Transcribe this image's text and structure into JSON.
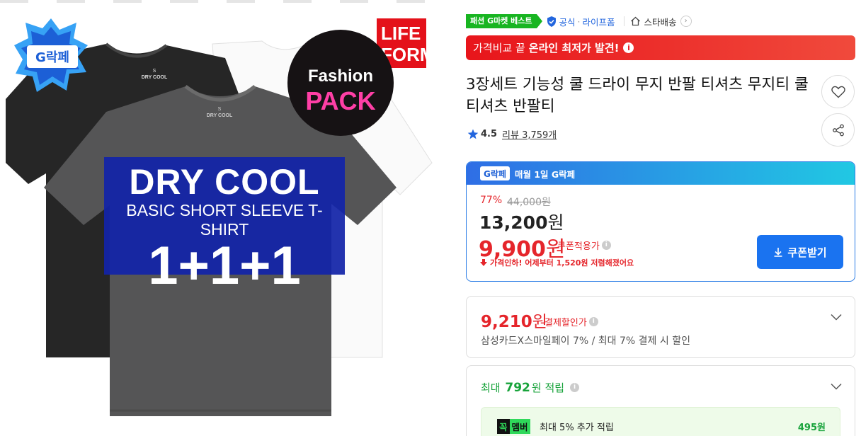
{
  "image": {
    "badge_text": "G락페",
    "life_text": "LIFE\nFORM",
    "fashion_pack_line1": "Fashion",
    "fashion_pack_line2": "PACK",
    "banner_line1": "DRY COOL",
    "banner_line2": "BASIC SHORT SLEEVE T-SHIRT",
    "banner_line3": "1+1+1",
    "label_size": "S",
    "label_brand": "DRY COOL"
  },
  "tags": {
    "best": "패션 G마켓 베스트",
    "official": "공식",
    "official_store": "라이프폼",
    "delivery": "스타배송"
  },
  "price_banner": {
    "prefix": "가격비교 끝",
    "highlight": "온라인 최저가 발견!"
  },
  "product": {
    "title": "3장세트 기능성 쿨 드라이 무지 반팔 티셔츠 무지티 쿨 티셔츠 반팔티",
    "rating": "4.5",
    "review_label": "리뷰",
    "review_count": "3,759개"
  },
  "coupon_box": {
    "header": "매월 1일 G락페",
    "discount_pct": "77%",
    "original_price": "44,000원",
    "sale_price": "13,200",
    "coupon_price": "9,900",
    "won": "원",
    "coupon_note": "쿠폰적용가",
    "drop_note": "가격인하! 어제부터 1,520원 저렴해졌어요",
    "button_label": "쿠폰받기"
  },
  "payment": {
    "price": "9,210",
    "won": "원",
    "label": "결제할인가",
    "desc": "삼성카드X스마일페이 7% / 최대 7% 결제 시 할인"
  },
  "points": {
    "prefix": "최대",
    "amount": "792",
    "suffix": "원 적립",
    "member_k": "꼭",
    "member_l": "멤버",
    "member_text": "최대 5% 추가 적립",
    "member_value": "495원"
  },
  "colors": {
    "accent_red": "#e5252b",
    "accent_blue": "#1a73f0",
    "green": "#18b521"
  }
}
